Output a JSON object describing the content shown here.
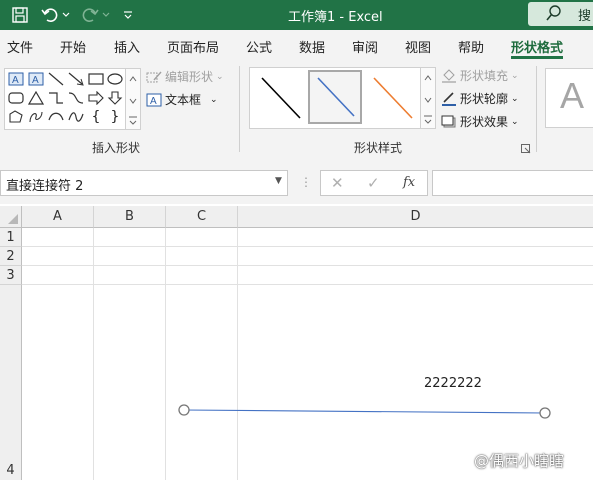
{
  "title_bar": {
    "window_title": "工作簿1  -  Excel",
    "search_label": "搜"
  },
  "menu": {
    "tabs": [
      {
        "label": "文件"
      },
      {
        "label": "开始"
      },
      {
        "label": "插入"
      },
      {
        "label": "页面布局"
      },
      {
        "label": "公式"
      },
      {
        "label": "数据"
      },
      {
        "label": "审阅"
      },
      {
        "label": "视图"
      },
      {
        "label": "帮助"
      },
      {
        "label": "形状格式",
        "active": true
      }
    ]
  },
  "ribbon": {
    "insert_shapes_group": "插入形状",
    "edit_shape": "编辑形状",
    "text_box": "文本框",
    "shape_styles_group": "形状样式",
    "shape_fill": "形状填充",
    "shape_outline": "形状轮廓",
    "shape_effects": "形状效果",
    "wordart_letter": "A",
    "style_colors": [
      "#000000",
      "#4472c4",
      "#ed7d31"
    ]
  },
  "formula_bar": {
    "name_box": "直接连接符 2",
    "fx": "fx",
    "formula": ""
  },
  "sheet": {
    "columns": [
      "A",
      "B",
      "C",
      "D"
    ],
    "rows": [
      "1",
      "2",
      "3",
      "4"
    ],
    "cell_text": "2222222",
    "connector_color": "#4472c4"
  },
  "watermark": "@偶西小瞎瞎"
}
